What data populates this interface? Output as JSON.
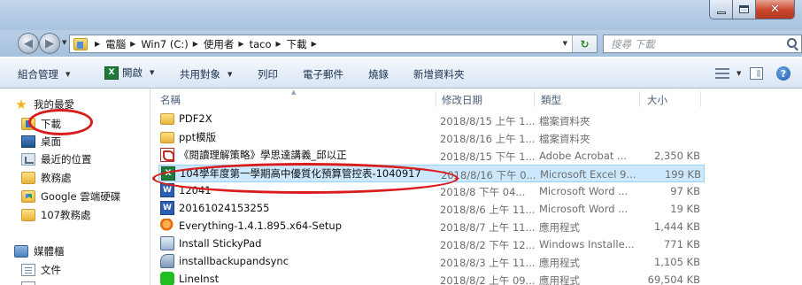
{
  "window": {
    "minimize_icon": "minimize-icon",
    "maximize_icon": "maximize-icon",
    "close_icon": "close-icon",
    "close_color": "#c9462c"
  },
  "nav": {
    "breadcrumbs": [
      "電腦",
      "Win7 (C:)",
      "使用者",
      "taco",
      "下載"
    ],
    "search_placeholder": "搜尋 下載"
  },
  "toolbar": {
    "organize": "組合管理",
    "open": "開啟",
    "share": "共用對象",
    "print": "列印",
    "email": "電子郵件",
    "burn": "燒錄",
    "new_folder": "新增資料夾"
  },
  "sidebar": {
    "favorites": "我的最愛",
    "downloads": "下載",
    "desktop": "桌面",
    "recent": "最近的位置",
    "teaching": "教務處",
    "gdrive": "Google 雲端硬碟",
    "teaching107": "107教務處",
    "libraries": "媒體櫃",
    "documents": "文件",
    "last": "..."
  },
  "columns": {
    "name": "名稱",
    "modified": "修改日期",
    "type": "類型",
    "size": "大小"
  },
  "highlight_color": "#d91c1c",
  "selection_color": "#cce8ff",
  "files": [
    {
      "name": "PDF2X",
      "modified": "2018/8/15 上午 1...",
      "type": "檔案資料夾",
      "size": "",
      "icon": "folder"
    },
    {
      "name": "ppt模版",
      "modified": "2018/8/16 上午 1...",
      "type": "檔案資料夾",
      "size": "",
      "icon": "folder"
    },
    {
      "name": "《閱讀理解策略》學思達講義_邱以正",
      "modified": "2018/8/15 下午 1...",
      "type": "Adobe Acrobat ...",
      "size": "2,350 KB",
      "icon": "pdf"
    },
    {
      "name": "104學年度第一學期高中優質化預算管控表-1040917",
      "modified": "2018/8/16 下午 0...",
      "type": "Microsoft Excel 9...",
      "size": "199 KB",
      "icon": "excel",
      "selected": true
    },
    {
      "name": "12041",
      "modified": "2018/8 下午 04...",
      "type": "Microsoft Word ...",
      "size": "97 KB",
      "icon": "word"
    },
    {
      "name": "20161024153255",
      "modified": "2018/8/6 上午 11...",
      "type": "Microsoft Word ...",
      "size": "19 KB",
      "icon": "word"
    },
    {
      "name": "Everything-1.4.1.895.x64-Setup",
      "modified": "2018/8/7 上午 11...",
      "type": "應用程式",
      "size": "1,444 KB",
      "icon": "search"
    },
    {
      "name": "Install StickyPad",
      "modified": "2018/8/2 下午 12...",
      "type": "Windows Installe...",
      "size": "771 KB",
      "icon": "install"
    },
    {
      "name": "installbackupandsync",
      "modified": "2018/8/3 上午 11...",
      "type": "應用程式",
      "size": "1,105 KB",
      "icon": "setup"
    },
    {
      "name": "LineInst",
      "modified": "2018/8/2 上午 09...",
      "type": "應用程式",
      "size": "69,504 KB",
      "icon": "line"
    }
  ]
}
